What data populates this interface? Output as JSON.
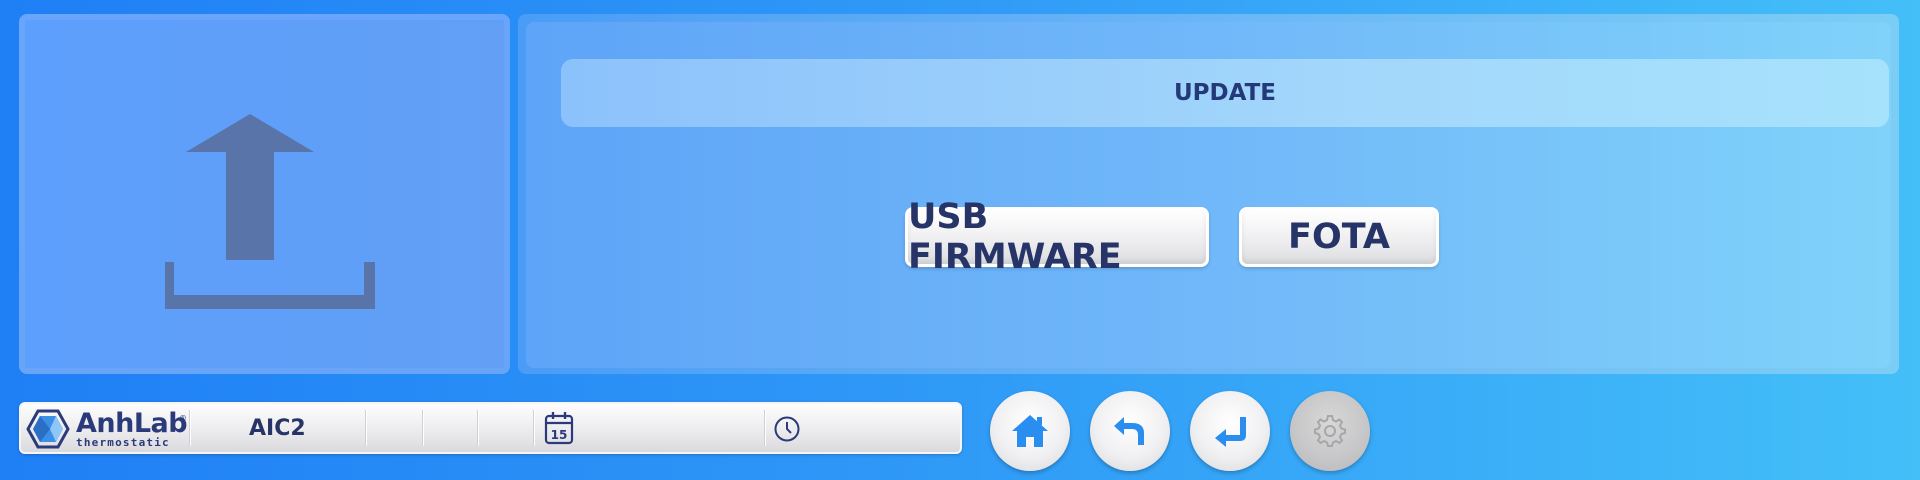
{
  "page": {
    "title": "UPDATE",
    "icon": "upload-icon"
  },
  "actions": {
    "usb_firmware_label": "USB FIRMWARE",
    "fota_label": "FOTA"
  },
  "status_bar": {
    "logo_name": "AnhLab",
    "logo_registered": "®",
    "logo_tagline": "thermostatic",
    "device_name": "AIC2",
    "calendar_icon_day": "15",
    "date": "",
    "time": ""
  },
  "nav_buttons": [
    {
      "icon": "home-icon",
      "enabled": true
    },
    {
      "icon": "back-icon",
      "enabled": true
    },
    {
      "icon": "enter-icon",
      "enabled": true
    },
    {
      "icon": "gear-icon",
      "enabled": false
    }
  ],
  "colors": {
    "text_primary": "#263468",
    "accent_blue": "#2a8df0",
    "icon_dim": "#5874a8"
  }
}
